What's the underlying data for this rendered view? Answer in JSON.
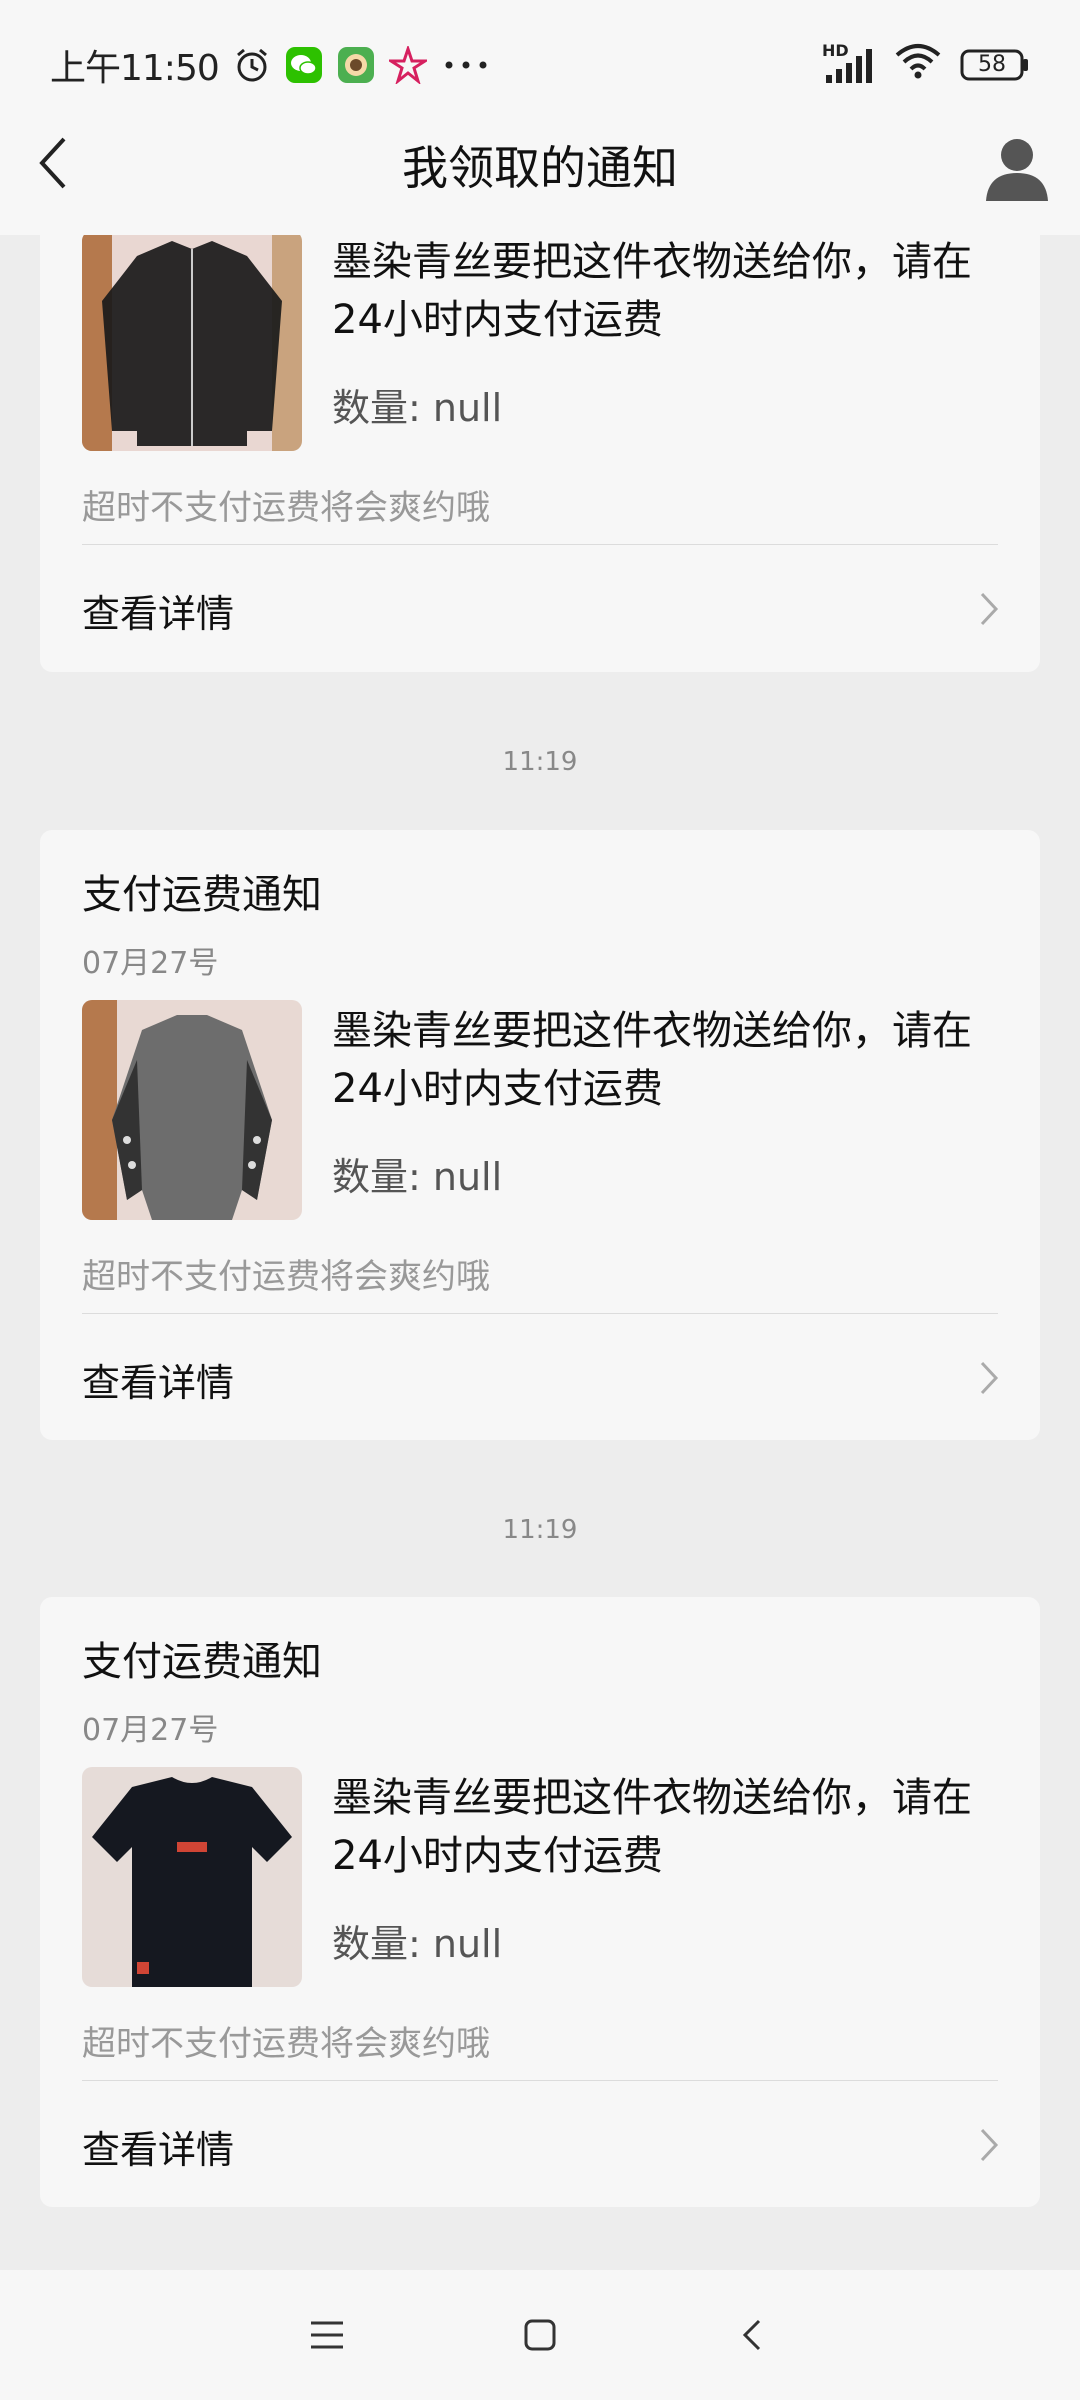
{
  "status_bar": {
    "time": "上午11:50",
    "battery": "58",
    "network_label": "HD",
    "icons": [
      "alarm-icon",
      "wechat-icon",
      "app-icon",
      "star-icon",
      "more-dots-icon",
      "signal-icon",
      "wifi-icon",
      "battery-icon"
    ]
  },
  "nav": {
    "title": "我领取的通知",
    "back_icon": "back-arrow-icon",
    "user_icon": "user-avatar-icon"
  },
  "timestamps": [
    "11:19",
    "11:19"
  ],
  "cards": [
    {
      "title": "",
      "date": "",
      "message": "墨染青丝要把这件衣物送给你，请在24小时内支付运费",
      "quantity": "数量: null",
      "hint": "超时不支付运费将会爽约哦",
      "link": "查看详情"
    },
    {
      "title": "支付运费通知",
      "date": "07月27号",
      "message": "墨染青丝要把这件衣物送给你，请在24小时内支付运费",
      "quantity": "数量: null",
      "hint": "超时不支付运费将会爽约哦",
      "link": "查看详情"
    },
    {
      "title": "支付运费通知",
      "date": "07月27号",
      "message": "墨染青丝要把这件衣物送给你，请在24小时内支付运费",
      "quantity": "数量: null",
      "hint": "超时不支付运费将会爽约哦",
      "link": "查看详情"
    }
  ],
  "colors": {
    "background": "#ededed",
    "card": "#f7f7f7",
    "secondary_text": "#888888"
  }
}
